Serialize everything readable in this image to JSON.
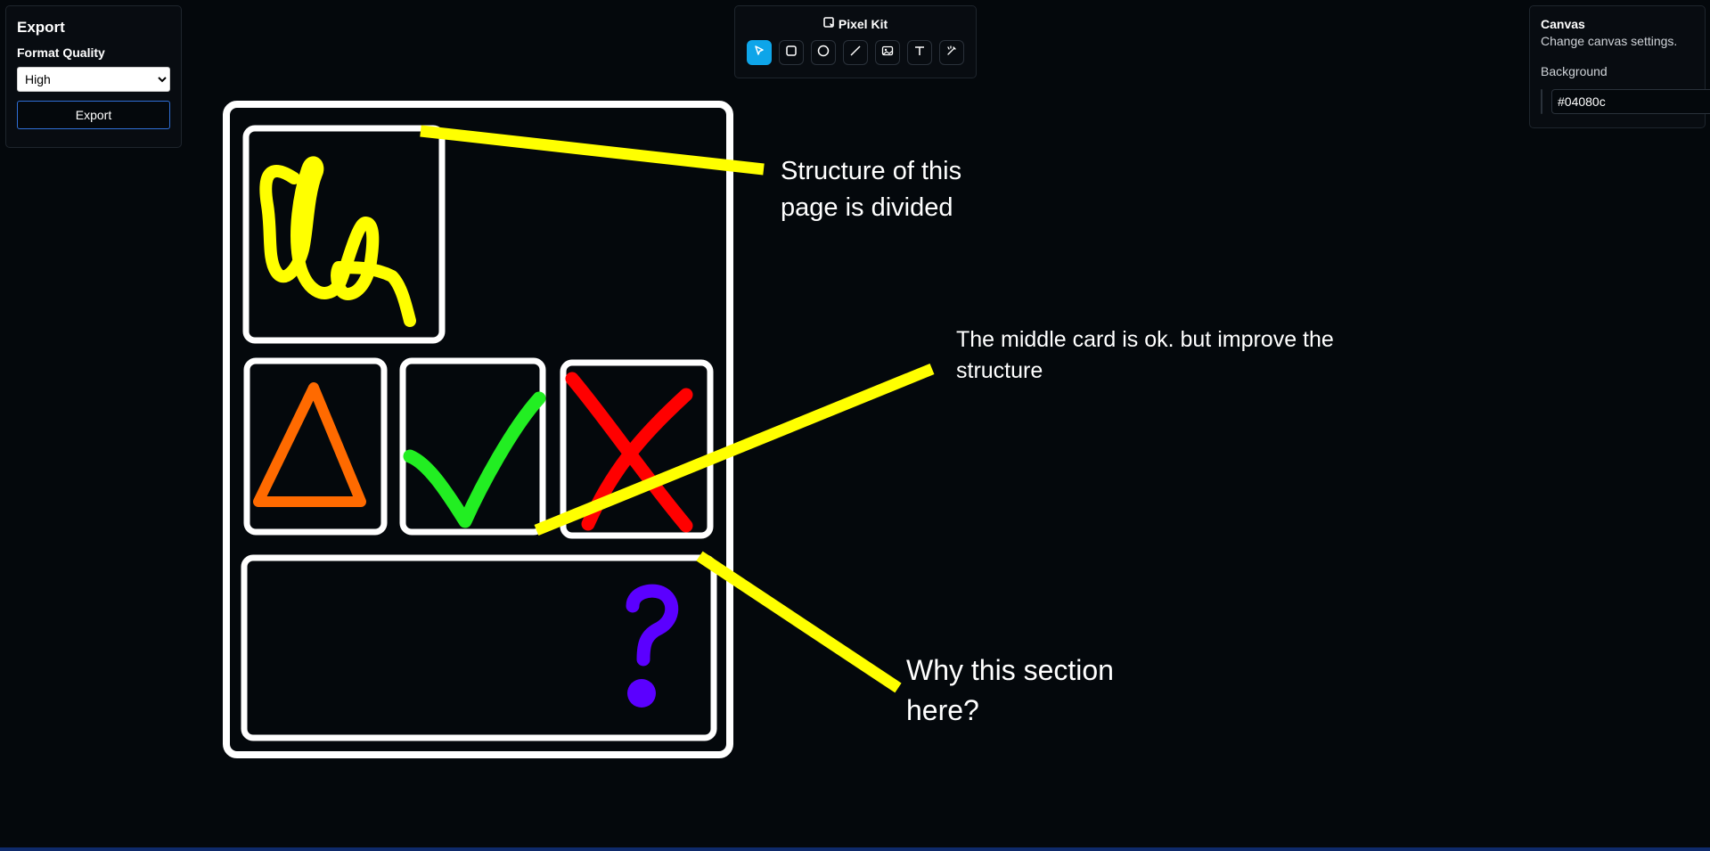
{
  "export_panel": {
    "title": "Export",
    "quality_label": "Format Quality",
    "quality_value": "High",
    "export_button": "Export"
  },
  "toolbar": {
    "brand": "Pixel Kit",
    "tools": [
      {
        "name": "select-tool",
        "icon": "cursor-icon",
        "active": true
      },
      {
        "name": "rectangle-tool",
        "icon": "rounded-square-icon",
        "active": false
      },
      {
        "name": "ellipse-tool",
        "icon": "circle-icon",
        "active": false
      },
      {
        "name": "line-tool",
        "icon": "diagonal-line-icon",
        "active": false
      },
      {
        "name": "image-tool",
        "icon": "image-icon",
        "active": false
      },
      {
        "name": "text-tool",
        "icon": "text-icon",
        "active": false
      },
      {
        "name": "pen-tool",
        "icon": "pen-icon",
        "active": false
      }
    ]
  },
  "canvas_panel": {
    "title": "Canvas",
    "subtitle": "Change canvas settings.",
    "background_label": "Background",
    "background_value": "#04080c"
  },
  "notes": {
    "note_1": "Structure of this page is divided",
    "note_2": "The middle card is ok. but improve the structure",
    "note_3": "Why this section here?"
  },
  "colors": {
    "background": "#04080c",
    "stroke_white": "#ffffff",
    "yellow": "#ffff00",
    "orange": "#ff6a00",
    "green": "#22ee22",
    "red": "#ff0000",
    "purple": "#5b00ff",
    "accent": "#0ea5e9"
  }
}
